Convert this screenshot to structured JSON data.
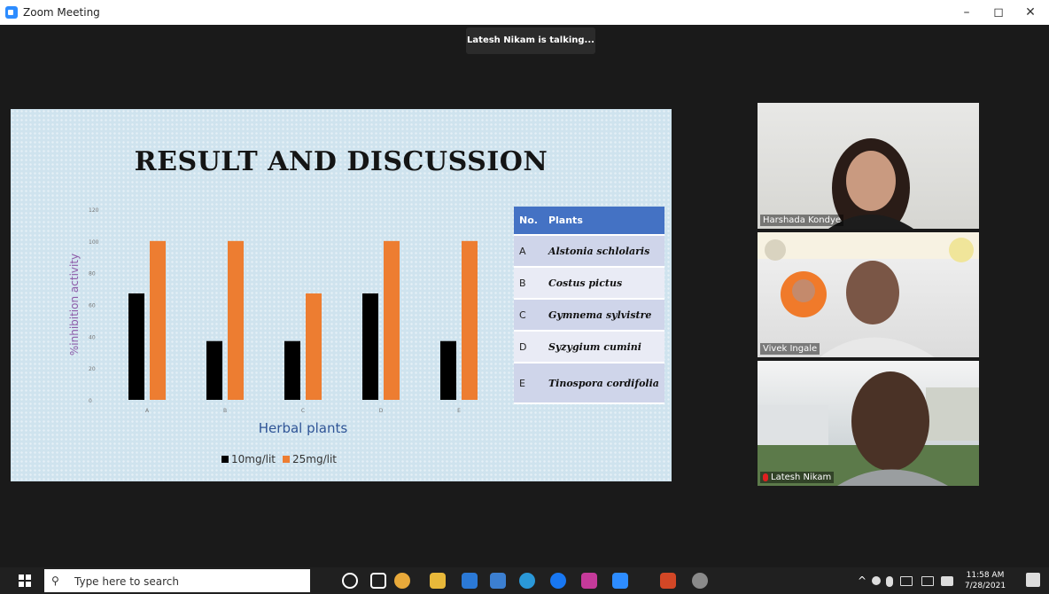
{
  "window": {
    "title": "Zoom Meeting",
    "minimize": "–",
    "maximize": "◻",
    "close": "✕"
  },
  "meeting": {
    "talking_indicator": "Latesh Nikam is talking..."
  },
  "slide": {
    "title": "RESULT AND DISCUSSION",
    "table": {
      "headers": [
        "No.",
        "Plants"
      ],
      "rows": [
        {
          "no": "A",
          "plant": "Alstonia schlolaris"
        },
        {
          "no": "B",
          "plant": "Costus pictus"
        },
        {
          "no": "C",
          "plant": "Gymnema sylvistre"
        },
        {
          "no": "D",
          "plant": "Syzygium cumini"
        },
        {
          "no": "E",
          "plant": "Tinospora cordifolia"
        }
      ]
    }
  },
  "chart_data": {
    "type": "bar",
    "categories": [
      "A",
      "B",
      "C",
      "D",
      "E"
    ],
    "series": [
      {
        "name": "10mg/lit",
        "values": [
          67,
          37,
          37,
          67,
          37
        ],
        "color": "#000000"
      },
      {
        "name": "25mg/lit",
        "values": [
          100,
          100,
          67,
          100,
          100
        ],
        "color": "#ed7d31"
      }
    ],
    "xlabel": "Herbal plants",
    "ylabel": "%inhibition activity",
    "ylim": [
      0,
      120
    ],
    "yticks": [
      "0",
      "20",
      "40",
      "60",
      "80",
      "100",
      "120"
    ],
    "legend_position": "bottom",
    "grid": false
  },
  "participants": [
    {
      "name": "Harshada Kondye"
    },
    {
      "name": "Vivek Ingale"
    },
    {
      "name": "Latesh Nikam",
      "muted": true
    }
  ],
  "taskbar": {
    "search_placeholder": "Type here to search",
    "time": "11:58 AM",
    "date": "7/28/2021",
    "notification_count": "2"
  },
  "colors": {
    "accent": "#2d8cff",
    "table_header": "#4472c4",
    "bar_primary": "#000000",
    "bar_secondary": "#ed7d31"
  }
}
